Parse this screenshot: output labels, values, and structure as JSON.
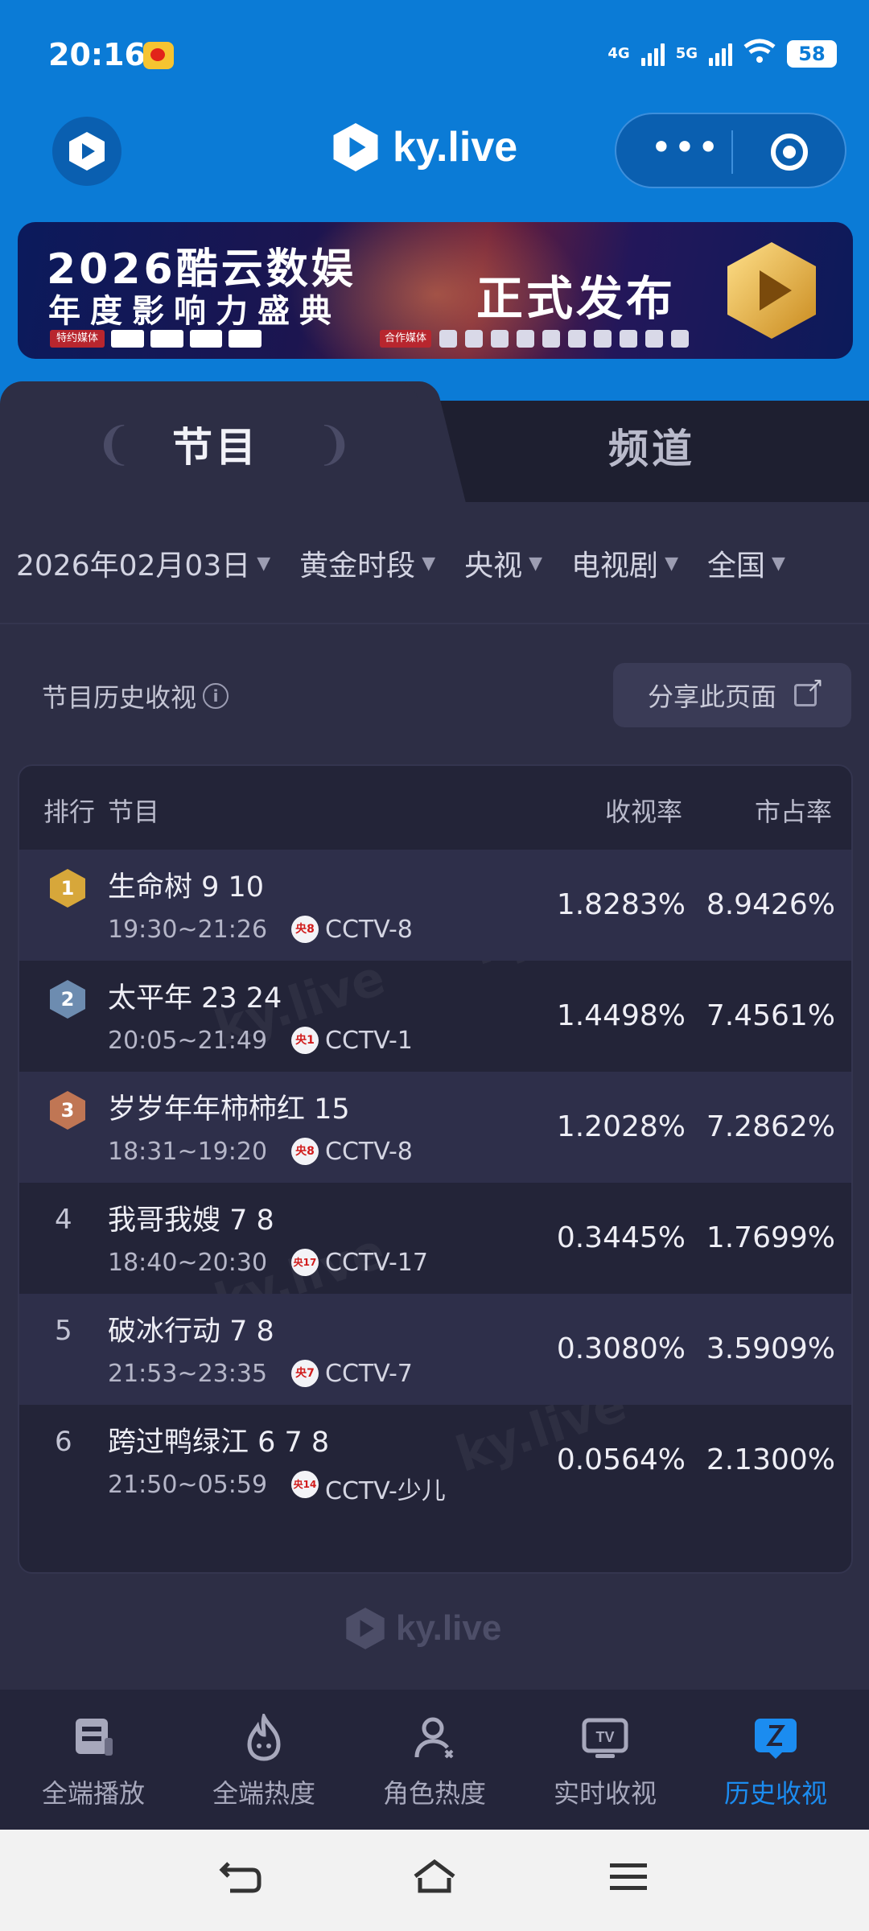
{
  "status_bar": {
    "time": "20:16",
    "net1": "4G",
    "net2": "5G",
    "battery": "58"
  },
  "header": {
    "brand": "ky.live"
  },
  "banner": {
    "title_line1": "2026酷云数娱",
    "title_line2": "年度影响力盛典",
    "cta": "正式发布",
    "sponsor_label": "特约媒体",
    "partner_label": "合作媒体"
  },
  "tabs": [
    {
      "label": "节目",
      "active": true
    },
    {
      "label": "频道",
      "active": false
    }
  ],
  "filters": [
    {
      "label": "2026年02月03日"
    },
    {
      "label": "黄金时段"
    },
    {
      "label": "央视"
    },
    {
      "label": "电视剧"
    },
    {
      "label": "全国"
    }
  ],
  "section": {
    "title": "节目历史收视",
    "info_icon": "i",
    "share_label": "分享此页面"
  },
  "table": {
    "headers": {
      "rank": "排行",
      "program": "节目",
      "rating": "收视率",
      "share": "市占率"
    },
    "rows": [
      {
        "rank": "1",
        "name": "生命树 9 10",
        "time": "19:30~21:26",
        "channel_logo": "央8",
        "channel": "CCTV-8",
        "rating": "1.8283%",
        "share": "8.9426%"
      },
      {
        "rank": "2",
        "name": "太平年 23 24",
        "time": "20:05~21:49",
        "channel_logo": "央1",
        "channel": "CCTV-1",
        "rating": "1.4498%",
        "share": "7.4561%"
      },
      {
        "rank": "3",
        "name": "岁岁年年柿柿红 15",
        "time": "18:31~19:20",
        "channel_logo": "央8",
        "channel": "CCTV-8",
        "rating": "1.2028%",
        "share": "7.2862%"
      },
      {
        "rank": "4",
        "name": "我哥我嫂 7 8",
        "time": "18:40~20:30",
        "channel_logo": "央17",
        "channel": "CCTV-17",
        "rating": "0.3445%",
        "share": "1.7699%"
      },
      {
        "rank": "5",
        "name": "破冰行动 7 8",
        "time": "21:53~23:35",
        "channel_logo": "央7",
        "channel": "CCTV-7",
        "rating": "0.3080%",
        "share": "3.5909%"
      },
      {
        "rank": "6",
        "name": "跨过鸭绿江 6 7 8",
        "time": "21:50~05:59",
        "channel_logo": "央14",
        "channel": "CCTV-少儿",
        "rating": "0.0564%",
        "share": "2.1300%"
      }
    ]
  },
  "footer": {
    "brand": "ky.live"
  },
  "bottom_nav": [
    {
      "label": "全端播放",
      "icon": "play-panel-icon",
      "active": false
    },
    {
      "label": "全端热度",
      "icon": "flame-icon",
      "active": false
    },
    {
      "label": "角色热度",
      "icon": "user-icon",
      "active": false
    },
    {
      "label": "实时收视",
      "icon": "tv-icon",
      "active": false
    },
    {
      "label": "历史收视",
      "icon": "history-icon",
      "active": true
    }
  ],
  "colors": {
    "accent": "#0b7bd6",
    "active_nav": "#1b8cf0",
    "gold": "#d7a73a",
    "silver": "#6d8cb0",
    "bronze": "#c07654"
  }
}
